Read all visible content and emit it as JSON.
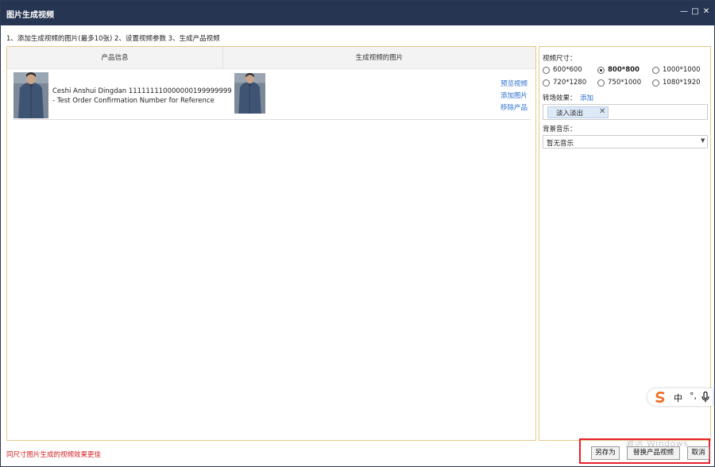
{
  "window": {
    "title": "图片生成视频",
    "minimize": "—",
    "maximize": "□",
    "close": "✕"
  },
  "instructions": "1、添加生成视频的图片(最多10张) 2、设置视频参数 3、生成产品视频",
  "table": {
    "headers": [
      "产品信息",
      "生成视频的图片"
    ],
    "rows": [
      {
        "product_name": "Ceshi Anshui Dingdan 111111110000000199999999 - Test Order Confirmation Number for Reference",
        "actions": [
          "预览视频",
          "添加图片",
          "移除产品"
        ]
      }
    ]
  },
  "settings": {
    "size_label": "视频尺寸：",
    "sizes": [
      {
        "label": "600*600",
        "selected": false
      },
      {
        "label": "800*800",
        "selected": true
      },
      {
        "label": "1000*1000",
        "selected": false
      },
      {
        "label": "720*1280",
        "selected": false
      },
      {
        "label": "750*1000",
        "selected": false
      },
      {
        "label": "1080*1920",
        "selected": false
      }
    ],
    "transition_label": "转场效果：",
    "transition_add": "添加",
    "transition_tag": "淡入淡出",
    "tag_remove": "✕",
    "music_label": "背景音乐：",
    "music_value": "暂无音乐",
    "music_arrow": "▼"
  },
  "ime": {
    "lang": "中",
    "punct": "°,"
  },
  "footer": {
    "hint": "同尺寸图片生成的视频效果更佳",
    "watermark": "激活 Windows",
    "buttons": {
      "save_as": "另存为",
      "replace": "替换产品视频",
      "cancel": "取消"
    }
  },
  "colors": {
    "titlebar": "#263552",
    "link": "#2a6fd0",
    "hint": "#d62020",
    "highlight": "#e8202a",
    "panel_border": "#e6c98a",
    "ime_logo": "#f36a1c"
  }
}
